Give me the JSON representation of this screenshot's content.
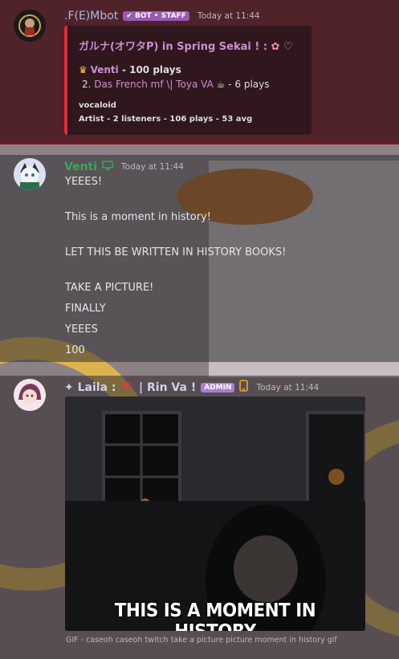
{
  "bot_message": {
    "username": ".F(E)Mbot",
    "tag": "✔ BOT • STAFF",
    "time": "Today at 11:44",
    "embed": {
      "title": "ガルナ(オワタP) in Spring Sekai ! :",
      "rank1_name": "Venti",
      "rank1_plays": " - 100 plays",
      "rank2_num": "2.",
      "rank2_name": "Das French mf \\| Toya VA",
      "rank2_plays": " - 6 plays",
      "genre": "vocaloid",
      "stats": "Artist - 2 listeners - 106 plays - 53 avg"
    }
  },
  "venti_message": {
    "username": "Venti",
    "time": "Today at 11:44",
    "lines": [
      "YEEES!",
      "This is a moment in history!",
      "LET THIS BE WRITTEN IN HISTORY BOOKS!",
      "TAKE A PICTURE!",
      "FINALLY",
      "YEEES",
      "100"
    ]
  },
  "laila_message": {
    "username_prefix": "✦ Laila :",
    "username_suffix": "| Rin Va !",
    "role_tag": "ADMIN",
    "time": "Today at 11:44",
    "gif_caption_overlay": "THIS IS A MOMENT IN HISTORY",
    "gif_description": "GIF - caseoh caseoh twitch take a picture picture moment in history gif"
  },
  "colors": {
    "bot_name": "#a8b9e6",
    "venti_name": "#3ba55d",
    "laila_name": "#c9d3e6",
    "bot_tag": "#9b59b6",
    "admin_tag": "#a77fd6",
    "embed_bar": "#e6283c"
  }
}
